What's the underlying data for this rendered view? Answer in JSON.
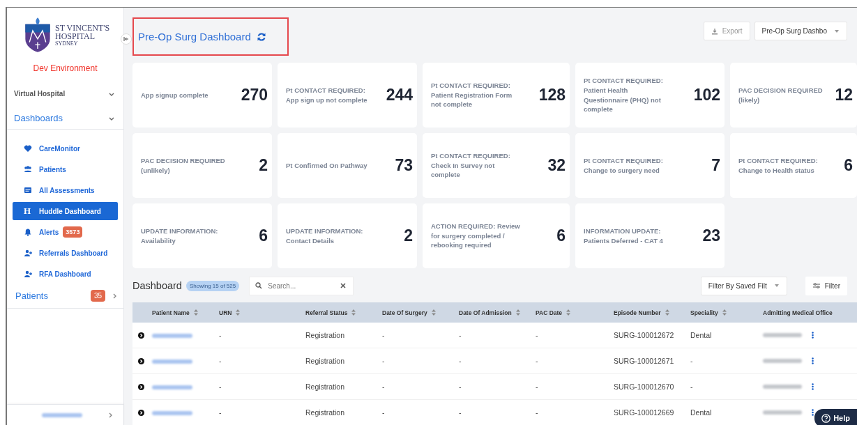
{
  "sidebar": {
    "logo": {
      "line1": "ST VINCENT'S",
      "line2": "HOSPITAL",
      "line3": "SYDNEY"
    },
    "environment": "Dev Environment",
    "sections": [
      {
        "label": "Virtual Hospital",
        "kind": "plain"
      },
      {
        "label": "Dashboards",
        "kind": "heading"
      }
    ],
    "items": [
      {
        "label": "CareMonitor",
        "kind": "heart",
        "selected": false
      },
      {
        "label": "Patients",
        "kind": "users",
        "selected": false
      },
      {
        "label": "All Assessments",
        "kind": "card",
        "selected": false
      },
      {
        "label": "Huddle Dashboard",
        "kind": "letter",
        "glyph": "H",
        "selected": true
      },
      {
        "label": "Alerts",
        "kind": "bell",
        "badge": "3573",
        "selected": false
      },
      {
        "label": "Referrals Dashboard",
        "kind": "adduser",
        "selected": false
      },
      {
        "label": "RFA Dashboard",
        "kind": "adduser",
        "selected": false
      }
    ],
    "patients": {
      "label": "Patients",
      "badge": "35"
    }
  },
  "header": {
    "title": "Pre-Op Surg Dashboard",
    "export": "Export",
    "dashboard_select": "Pre-Op Surg Dashbo"
  },
  "cards": [
    {
      "label": "App signup complete",
      "value": "270"
    },
    {
      "label": "Pt CONTACT REQUIRED: App sign up not complete",
      "value": "244"
    },
    {
      "label": "Pt CONTACT REQUIRED: Patient Registration Form not complete",
      "value": "128"
    },
    {
      "label": "Pt CONTACT REQUIRED: Patient Health Questionnaire (PHQ) not complete",
      "value": "102"
    },
    {
      "label": "PAC DECISION REQUIRED (likely)",
      "value": "12"
    },
    {
      "label": "PAC DECISION REQUIRED (unlikely)",
      "value": "2"
    },
    {
      "label": "Pt Confirmed On Pathway",
      "value": "73"
    },
    {
      "label": "Pt CONTACT REQUIRED: Check In Survey not complete",
      "value": "32"
    },
    {
      "label": "Pt CONTACT REQUIRED: Change to surgery need",
      "value": "7"
    },
    {
      "label": "Pt CONTACT REQUIRED: Change to Health status",
      "value": "6"
    },
    {
      "label": "UPDATE INFORMATION: Availability",
      "value": "6"
    },
    {
      "label": "UPDATE INFORMATION: Contact Details",
      "value": "2"
    },
    {
      "label": "ACTION REQUIRED: Review for surgery completed / rebooking required",
      "value": "6"
    },
    {
      "label": "INFORMATION UPDATE: Patients Deferred - CAT 4",
      "value": "23"
    }
  ],
  "table_toolbar": {
    "title": "Dashboard",
    "count": "Showing 15 of 525",
    "search": {
      "placeholder": "Search..."
    },
    "saved_filter": "Filter By Saved Filt",
    "filter": "Filter"
  },
  "table": {
    "columns": [
      "Patient Name",
      "URN",
      "Referral Status",
      "Date Of Surgery",
      "Date Of Admission",
      "PAC Date",
      "Episode Number",
      "Speciality",
      "Admitting Medical Office"
    ],
    "rows": [
      {
        "urn": "-",
        "referral_status": "Registration",
        "date_of_surgery": "-",
        "date_of_admission": "-",
        "pac_date": "-",
        "episode_number": "SURG-100012672",
        "speciality": "Dental"
      },
      {
        "urn": "-",
        "referral_status": "Registration",
        "date_of_surgery": "-",
        "date_of_admission": "-",
        "pac_date": "-",
        "episode_number": "SURG-100012671",
        "speciality": "-"
      },
      {
        "urn": "-",
        "referral_status": "Registration",
        "date_of_surgery": "-",
        "date_of_admission": "-",
        "pac_date": "-",
        "episode_number": "SURG-100012670",
        "speciality": "-"
      },
      {
        "urn": "-",
        "referral_status": "Registration",
        "date_of_surgery": "-",
        "date_of_admission": "-",
        "pac_date": "-",
        "episode_number": "SURG-100012669",
        "speciality": "Dental"
      }
    ]
  },
  "help": "Help"
}
